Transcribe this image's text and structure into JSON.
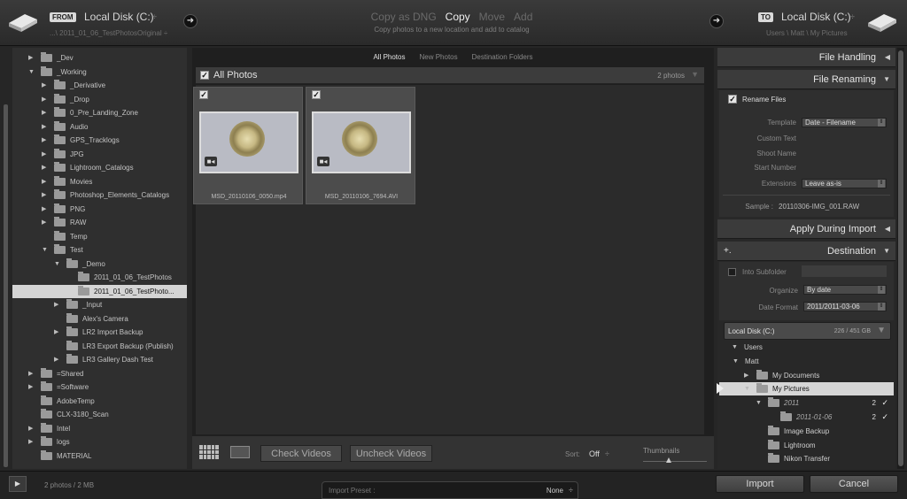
{
  "header": {
    "from_badge": "FROM",
    "source_title": "Local Disk (C:)",
    "source_path": "...\\ 2011_01_06_TestPhotosOriginal ÷",
    "modes": [
      "Copy as DNG",
      "Copy",
      "Move",
      "Add"
    ],
    "active_mode": "Copy",
    "mode_description": "Copy photos to a new location and add to catalog",
    "to_badge": "TO",
    "dest_title": "Local Disk (C:)",
    "dest_path": "Users \\ Matt \\ My Pictures",
    "spinner": "÷"
  },
  "source_tree": [
    {
      "label": "_Dev",
      "indent": 1,
      "arrow": "▶"
    },
    {
      "label": "_Working",
      "indent": 1,
      "arrow": "▼"
    },
    {
      "label": "_Derivative",
      "indent": 2,
      "arrow": "▶"
    },
    {
      "label": "_Drop",
      "indent": 2,
      "arrow": "▶"
    },
    {
      "label": "0_Pre_Landing_Zone",
      "indent": 2,
      "arrow": "▶"
    },
    {
      "label": "Audio",
      "indent": 2,
      "arrow": "▶"
    },
    {
      "label": "GPS_Tracklogs",
      "indent": 2,
      "arrow": "▶"
    },
    {
      "label": "JPG",
      "indent": 2,
      "arrow": "▶"
    },
    {
      "label": "Lightroom_Catalogs",
      "indent": 2,
      "arrow": "▶"
    },
    {
      "label": "Movies",
      "indent": 2,
      "arrow": "▶"
    },
    {
      "label": "Photoshop_Elements_Catalogs",
      "indent": 2,
      "arrow": "▶"
    },
    {
      "label": "PNG",
      "indent": 2,
      "arrow": "▶"
    },
    {
      "label": "RAW",
      "indent": 2,
      "arrow": "▶"
    },
    {
      "label": "Temp",
      "indent": 2,
      "arrow": ""
    },
    {
      "label": "Test",
      "indent": 2,
      "arrow": "▼"
    },
    {
      "label": "_Demo",
      "indent": 3,
      "arrow": "▼"
    },
    {
      "label": "2011_01_06_TestPhotos",
      "indent": 4,
      "arrow": ""
    },
    {
      "label": "2011_01_06_TestPhoto...",
      "indent": 4,
      "arrow": "",
      "selected": true
    },
    {
      "label": "_Input",
      "indent": 3,
      "arrow": "▶"
    },
    {
      "label": "Alex's Camera",
      "indent": 3,
      "arrow": ""
    },
    {
      "label": "LR2 Import Backup",
      "indent": 3,
      "arrow": "▶"
    },
    {
      "label": "LR3 Export Backup (Publish)",
      "indent": 3,
      "arrow": ""
    },
    {
      "label": "LR3 Gallery Dash Test",
      "indent": 3,
      "arrow": "▶"
    },
    {
      "label": "=Shared",
      "indent": 1,
      "arrow": "▶"
    },
    {
      "label": "=Software",
      "indent": 1,
      "arrow": "▶"
    },
    {
      "label": "AdobeTemp",
      "indent": 1,
      "arrow": ""
    },
    {
      "label": "CLX-3180_Scan",
      "indent": 1,
      "arrow": ""
    },
    {
      "label": "Intel",
      "indent": 1,
      "arrow": "▶"
    },
    {
      "label": "logs",
      "indent": 1,
      "arrow": "▶"
    },
    {
      "label": "MATERIAL",
      "indent": 1,
      "arrow": ""
    }
  ],
  "filter_tabs": [
    "All Photos",
    "New Photos",
    "Destination Folders"
  ],
  "grid": {
    "title": "All Photos",
    "count": "2 photos",
    "photos": [
      {
        "name": "MSD_20110106_0050.mp4",
        "checked": true
      },
      {
        "name": "MSD_20110106_7694.AVI",
        "checked": true
      }
    ]
  },
  "toolbar": {
    "check_videos": "Check Videos",
    "uncheck_videos": "Uncheck Videos",
    "sort_label": "Sort:",
    "sort_value": "Off",
    "thumbnails_label": "Thumbnails",
    "thumbnail_size": 0.4
  },
  "right": {
    "file_handling": "File Handling",
    "file_renaming": "File Renaming",
    "rename_files": "Rename Files",
    "template_label": "Template",
    "template_value": "Date - Filename",
    "custom_text_label": "Custom Text",
    "shoot_name_label": "Shoot Name",
    "start_number_label": "Start Number",
    "extensions_label": "Extensions",
    "extensions_value": "Leave as-is",
    "sample_label": "Sample :",
    "sample_value": "20110306-IMG_001.RAW",
    "apply_during_import": "Apply During Import",
    "destination": "Destination",
    "plus": "+.",
    "into_subfolder": "Into Subfolder",
    "organize_label": "Organize",
    "organize_value": "By date",
    "date_format_label": "Date Format",
    "date_format_value": "2011/2011-03-06",
    "volume_name": "Local Disk (C:)",
    "volume_space": "226 / 451 GB",
    "dest_tree": [
      {
        "label": "Users",
        "indent": 1,
        "arrow": "▼",
        "icon": false
      },
      {
        "label": "Matt",
        "indent": 2,
        "arrow": "▼",
        "icon": false
      },
      {
        "label": "My Documents",
        "indent": 3,
        "arrow": "▶",
        "icon": true
      },
      {
        "label": "My Pictures",
        "indent": 3,
        "arrow": "▼",
        "icon": true,
        "selected": true
      },
      {
        "label": "2011",
        "indent": 4,
        "arrow": "▼",
        "icon": true,
        "italic": true,
        "count": "2",
        "checked": true
      },
      {
        "label": "2011-01-06",
        "indent": 5,
        "arrow": "",
        "icon": true,
        "italic": true,
        "count": "2",
        "checked": true
      },
      {
        "label": "Image Backup",
        "indent": 4,
        "arrow": "",
        "icon": true
      },
      {
        "label": "Lightroom",
        "indent": 4,
        "arrow": "",
        "icon": true
      },
      {
        "label": "Nikon Transfer",
        "indent": 4,
        "arrow": "",
        "icon": true
      }
    ]
  },
  "footer": {
    "status": "2 photos / 2 MB",
    "preset_label": "Import Preset :",
    "preset_value": "None",
    "import": "Import",
    "cancel": "Cancel"
  }
}
